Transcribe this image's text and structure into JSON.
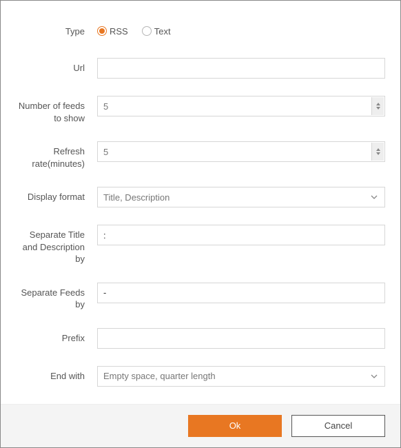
{
  "labels": {
    "type": "Type",
    "url": "Url",
    "num_feeds": "Number of feeds to show",
    "refresh_rate": "Refresh rate(minutes)",
    "display_format": "Display format",
    "separate_title_desc": "Separate Title and Description by",
    "separate_feeds": "Separate Feeds by",
    "prefix": "Prefix",
    "end_with": "End with"
  },
  "type": {
    "option_rss": "RSS",
    "option_text": "Text",
    "selected": "RSS"
  },
  "url": {
    "value": ""
  },
  "num_feeds": {
    "value": "5"
  },
  "refresh_rate": {
    "value": "5"
  },
  "display_format": {
    "value": "Title, Description"
  },
  "separate_title_desc": {
    "value": ":"
  },
  "separate_feeds": {
    "value": "-"
  },
  "prefix": {
    "value": ""
  },
  "end_with": {
    "value": "Empty space, quarter length"
  },
  "buttons": {
    "ok": "Ok",
    "cancel": "Cancel"
  },
  "colors": {
    "accent": "#e87722"
  }
}
